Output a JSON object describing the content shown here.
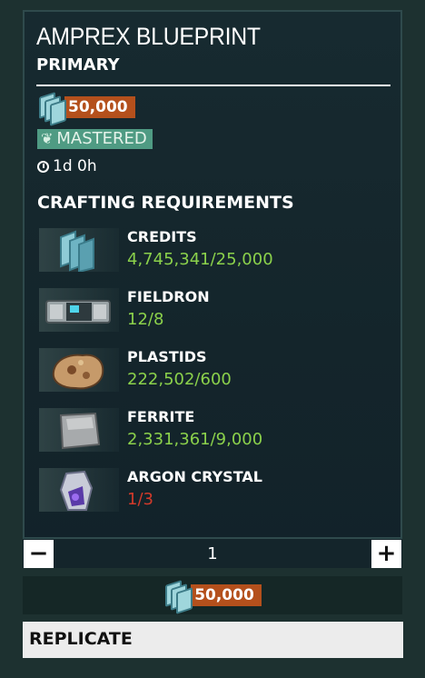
{
  "item": {
    "title": "AMPREX BLUEPRINT",
    "category": "PRIMARY",
    "price": "50,000",
    "mastered_label": "MASTERED",
    "build_time": "1d 0h"
  },
  "requirements": {
    "header": "CRAFTING REQUIREMENTS",
    "items": [
      {
        "name": "CREDITS",
        "count": "4,745,341/25,000",
        "status": "ok",
        "icon": "credits-icon"
      },
      {
        "name": "FIELDRON",
        "count": "12/8",
        "status": "ok",
        "icon": "fieldron-icon"
      },
      {
        "name": "PLASTIDS",
        "count": "222,502/600",
        "status": "ok",
        "icon": "plastids-icon"
      },
      {
        "name": "FERRITE",
        "count": "2,331,361/9,000",
        "status": "ok",
        "icon": "ferrite-icon"
      },
      {
        "name": "ARGON CRYSTAL",
        "count": "1/3",
        "status": "insufficient",
        "icon": "argon-crystal-icon"
      }
    ]
  },
  "quantity": {
    "minus": "−",
    "value": "1",
    "plus": "+"
  },
  "total": {
    "price": "50,000"
  },
  "action": {
    "replicate_label": "REPLICATE"
  },
  "colors": {
    "price_badge": "#b4501c",
    "mastered_badge": "#4f9b83",
    "count_ok": "#8bd14b",
    "count_insufficient": "#d23a2a"
  }
}
